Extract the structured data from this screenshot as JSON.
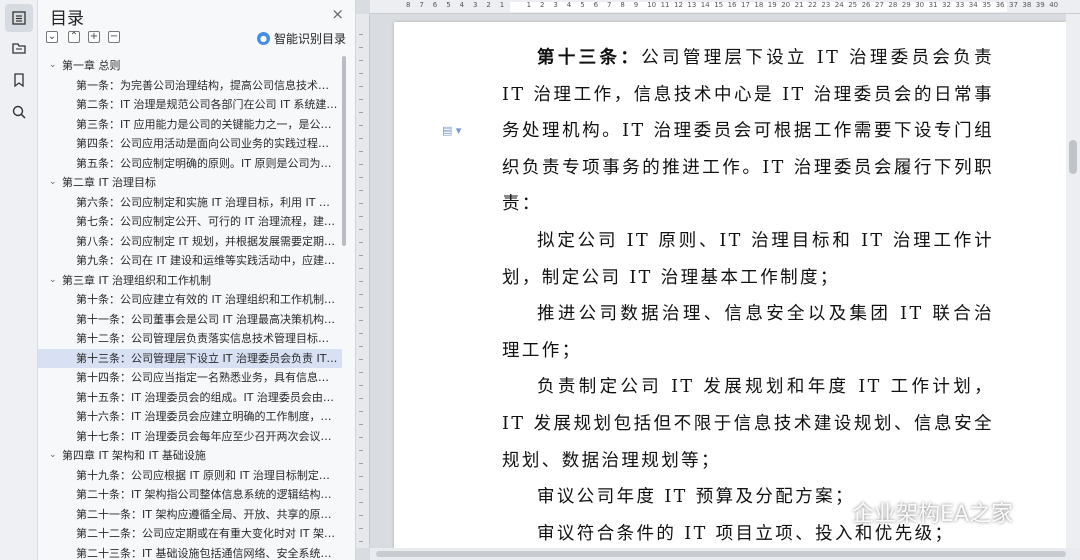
{
  "toc": {
    "title": "目录",
    "close_icon": "×",
    "smart_label": "智能识别目录",
    "items": [
      {
        "label": "第一章 总则",
        "level": 1
      },
      {
        "label": "第一条：为完善公司治理结构，提高公司信息技术（…",
        "level": 2
      },
      {
        "label": "第二条：IT 治理是规范公司各部门在公司 IT 系统建…",
        "level": 2
      },
      {
        "label": "第三条：IT 应用能力是公司的关键能力之一，是公司…",
        "level": 2
      },
      {
        "label": "第四条：公司应用活动是面向公司业务的实践过程，…",
        "level": 2
      },
      {
        "label": "第五条：公司应制定明确的原则。IT 原则是公司为实…",
        "level": 2
      },
      {
        "label": "第二章 IT 治理目标",
        "level": 1
      },
      {
        "label": "第六条：公司应制定和实施 IT 治理目标，利用 IT 增…",
        "level": 2
      },
      {
        "label": "第七条：公司应制定公开、可行的 IT 治理流程，建立…",
        "level": 2
      },
      {
        "label": "第八条：公司应制定 IT 规划，并根据发展需要定期更…",
        "level": 2
      },
      {
        "label": "第九条：公司在 IT 建设和运维等实践活动中，应建立…",
        "level": 2
      },
      {
        "label": "第三章 IT 治理组织和工作机制",
        "level": 1
      },
      {
        "label": "第十条：公司应建立有效的 IT 治理组织和工作机制，…",
        "level": 2
      },
      {
        "label": "第十一条：公司董事会是公司 IT 治理最高决策机构，…",
        "level": 2
      },
      {
        "label": "第十二条：公司管理层负责落实信息技术管理目标，…",
        "level": 2
      },
      {
        "label": "第十三条：公司管理层下设立 IT 治理委员会负责 IT …",
        "level": 2,
        "active": true
      },
      {
        "label": "第十四条：公司应当指定一名熟悉业务，具有信息技…",
        "level": 2
      },
      {
        "label": "第十五条：IT 治理委员会的组成。IT 治理委员会由主…",
        "level": 2
      },
      {
        "label": "第十六条：IT 治理委员会应建立明确的工作制度，确…",
        "level": 2
      },
      {
        "label": "第十七条：IT 治理委员会每年应至少召开两次会议，…",
        "level": 2
      },
      {
        "label": "第四章 IT 架构和 IT 基础设施",
        "level": 1
      },
      {
        "label": "第十九条：公司应根据 IT 原则和 IT 治理目标制定相…",
        "level": 2
      },
      {
        "label": "第二十条：IT 架构指公司整体信息系统的逻辑结构，…",
        "level": 2
      },
      {
        "label": "第二十一条：IT 架构应遵循全局、开放、共享的原则…",
        "level": 2
      },
      {
        "label": "第二十二条：公司应定期或在有重大变化时对 IT 架构…",
        "level": 2
      },
      {
        "label": "第二十三条：IT 基础设施包括通信网络、安全系统…",
        "level": 2
      }
    ]
  },
  "ruler": {
    "numbers": [
      "8",
      "7",
      "6",
      "5",
      "4",
      "3",
      "2",
      "1",
      "",
      "1",
      "2",
      "3",
      "4",
      "5",
      "6",
      "7",
      "8",
      "9",
      "10",
      "11",
      "12",
      "13",
      "14",
      "15",
      "16",
      "17",
      "18",
      "19",
      "20",
      "21",
      "22",
      "23",
      "24",
      "25",
      "26",
      "27",
      "28",
      "29",
      "30",
      "31",
      "32",
      "33",
      "34",
      "35",
      "36",
      "37",
      "38",
      "39",
      "40"
    ]
  },
  "document": {
    "heading_bold": "第十三条：",
    "heading_rest": "公司管理层下设立 IT 治理委员会负责 IT 治理工作，信息技术中心是 IT 治理委员会的日常事务处理机构。IT 治理委员会可根据工作需要下设专门组织负责专项事务的推进工作。IT 治理委员会履行下列职责：",
    "paragraphs": [
      "拟定公司 IT 原则、IT 治理目标和 IT 治理工作计划，制定公司 IT 治理基本工作制度；",
      "推进公司数据治理、信息安全以及集团 IT 联合治理工作；",
      "负责制定公司 IT 发展规划和年度 IT 工作计划，IT 发展规划包括但不限于信息技术建设规划、信息安全规划、数据治理规划等；",
      "审议公司年度 IT 预算及分配方案；",
      "审议符合条件的 IT 项目立项、投入和优先级；"
    ]
  },
  "watermark": {
    "text": "企业架构EA之家"
  }
}
